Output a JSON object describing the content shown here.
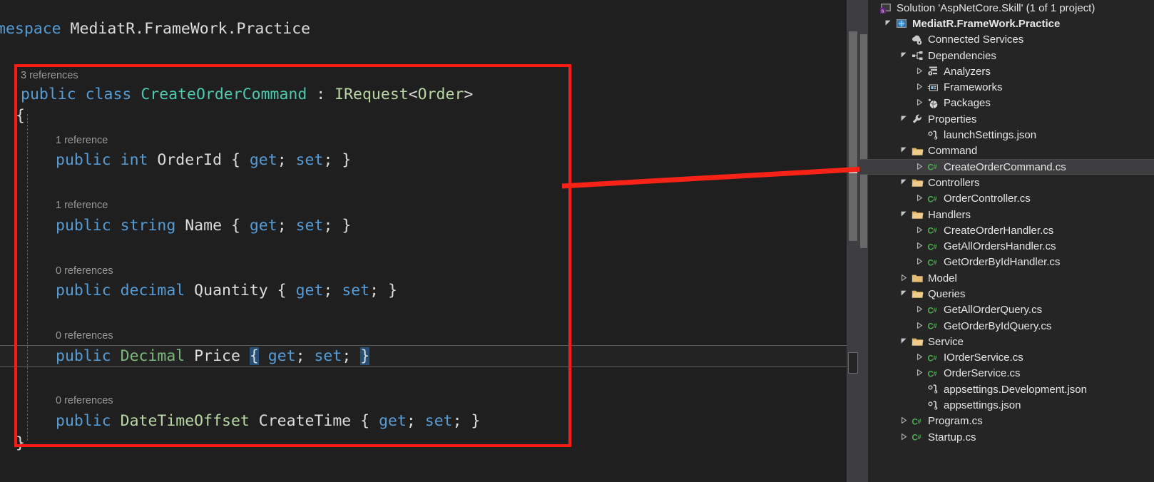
{
  "editor": {
    "namespace_line": {
      "kw": "mespace",
      "name": " MediatR.FrameWork.Practice"
    },
    "lines": [
      {
        "ref": "3 references",
        "tokens": [
          {
            "t": "public",
            "c": "kw"
          },
          {
            "t": " ",
            "c": "plain"
          },
          {
            "t": "class",
            "c": "kw"
          },
          {
            "t": " ",
            "c": "plain"
          },
          {
            "t": "CreateOrderCommand",
            "c": "type"
          },
          {
            "t": " : ",
            "c": "plain"
          },
          {
            "t": "IRequest",
            "c": "iface"
          },
          {
            "t": "<",
            "c": "plain"
          },
          {
            "t": "Order",
            "c": "iface"
          },
          {
            "t": ">",
            "c": "plain"
          }
        ]
      },
      {
        "ref": "1 reference",
        "tokens": [
          {
            "t": "public",
            "c": "kw"
          },
          {
            "t": " ",
            "c": "plain"
          },
          {
            "t": "int",
            "c": "kw"
          },
          {
            "t": " OrderId { ",
            "c": "plain"
          },
          {
            "t": "get",
            "c": "acc"
          },
          {
            "t": "; ",
            "c": "plain"
          },
          {
            "t": "set",
            "c": "acc"
          },
          {
            "t": "; }",
            "c": "plain"
          }
        ]
      },
      {
        "ref": "1 reference",
        "tokens": [
          {
            "t": "public",
            "c": "kw"
          },
          {
            "t": " ",
            "c": "plain"
          },
          {
            "t": "string",
            "c": "kw"
          },
          {
            "t": " Name { ",
            "c": "plain"
          },
          {
            "t": "get",
            "c": "acc"
          },
          {
            "t": "; ",
            "c": "plain"
          },
          {
            "t": "set",
            "c": "acc"
          },
          {
            "t": "; }",
            "c": "plain"
          }
        ]
      },
      {
        "ref": "0 references",
        "tokens": [
          {
            "t": "public",
            "c": "kw"
          },
          {
            "t": " ",
            "c": "plain"
          },
          {
            "t": "decimal",
            "c": "kw"
          },
          {
            "t": " Quantity { ",
            "c": "plain"
          },
          {
            "t": "get",
            "c": "acc"
          },
          {
            "t": "; ",
            "c": "plain"
          },
          {
            "t": "set",
            "c": "acc"
          },
          {
            "t": "; }",
            "c": "plain"
          }
        ]
      },
      {
        "ref": "0 references",
        "tokens": [
          {
            "t": "public",
            "c": "kw"
          },
          {
            "t": " ",
            "c": "plain"
          },
          {
            "t": "Decimal",
            "c": "type2"
          },
          {
            "t": " Price ",
            "c": "plain"
          },
          {
            "t": "{",
            "c": "brace-hl"
          },
          {
            "t": " ",
            "c": "plain"
          },
          {
            "t": "get",
            "c": "acc"
          },
          {
            "t": "; ",
            "c": "plain"
          },
          {
            "t": "set",
            "c": "acc"
          },
          {
            "t": "; ",
            "c": "plain"
          },
          {
            "t": "}",
            "c": "brace-hl"
          }
        ]
      },
      {
        "ref": "0 references",
        "tokens": [
          {
            "t": "public",
            "c": "kw"
          },
          {
            "t": " ",
            "c": "plain"
          },
          {
            "t": "DateTimeOffset",
            "c": "iface"
          },
          {
            "t": " CreateTime { ",
            "c": "plain"
          },
          {
            "t": "get",
            "c": "acc"
          },
          {
            "t": "; ",
            "c": "plain"
          },
          {
            "t": "set",
            "c": "acc"
          },
          {
            "t": "; }",
            "c": "plain"
          }
        ]
      }
    ],
    "open_brace": "{",
    "close_brace": "}"
  },
  "annotation": {
    "box_color": "#fb1b15",
    "arrow_color": "#f92216"
  },
  "solution_explorer": {
    "items": [
      {
        "label": "Solution 'AspNetCore.Skill' (1 of 1 project)",
        "indent": 0,
        "twisty": "none",
        "icon": "solution-icon",
        "bold": false,
        "selected": false
      },
      {
        "label": "MediatR.FrameWork.Practice",
        "indent": 1,
        "twisty": "open",
        "icon": "project-icon",
        "bold": true,
        "selected": false
      },
      {
        "label": "Connected Services",
        "indent": 2,
        "twisty": "none",
        "icon": "connected-services-icon",
        "bold": false,
        "selected": false
      },
      {
        "label": "Dependencies",
        "indent": 2,
        "twisty": "open",
        "icon": "dependencies-icon",
        "bold": false,
        "selected": false
      },
      {
        "label": "Analyzers",
        "indent": 3,
        "twisty": "closed",
        "icon": "analyzers-icon",
        "bold": false,
        "selected": false
      },
      {
        "label": "Frameworks",
        "indent": 3,
        "twisty": "closed",
        "icon": "frameworks-icon",
        "bold": false,
        "selected": false
      },
      {
        "label": "Packages",
        "indent": 3,
        "twisty": "closed",
        "icon": "packages-icon",
        "bold": false,
        "selected": false
      },
      {
        "label": "Properties",
        "indent": 2,
        "twisty": "open",
        "icon": "wrench-icon",
        "bold": false,
        "selected": false
      },
      {
        "label": "launchSettings.json",
        "indent": 3,
        "twisty": "none",
        "icon": "json-file-icon",
        "bold": false,
        "selected": false
      },
      {
        "label": "Command",
        "indent": 2,
        "twisty": "open",
        "icon": "folder-icon",
        "bold": false,
        "selected": false
      },
      {
        "label": "CreateOrderCommand.cs",
        "indent": 3,
        "twisty": "closed",
        "icon": "csharp-file-icon",
        "bold": false,
        "selected": true
      },
      {
        "label": "Controllers",
        "indent": 2,
        "twisty": "open",
        "icon": "folder-icon",
        "bold": false,
        "selected": false
      },
      {
        "label": "OrderController.cs",
        "indent": 3,
        "twisty": "closed",
        "icon": "csharp-file-icon",
        "bold": false,
        "selected": false
      },
      {
        "label": "Handlers",
        "indent": 2,
        "twisty": "open",
        "icon": "folder-icon",
        "bold": false,
        "selected": false
      },
      {
        "label": "CreateOrderHandler.cs",
        "indent": 3,
        "twisty": "closed",
        "icon": "csharp-file-icon",
        "bold": false,
        "selected": false
      },
      {
        "label": "GetAllOrdersHandler.cs",
        "indent": 3,
        "twisty": "closed",
        "icon": "csharp-file-icon",
        "bold": false,
        "selected": false
      },
      {
        "label": "GetOrderByIdHandler.cs",
        "indent": 3,
        "twisty": "closed",
        "icon": "csharp-file-icon",
        "bold": false,
        "selected": false
      },
      {
        "label": "Model",
        "indent": 2,
        "twisty": "closed",
        "icon": "folder-icon",
        "bold": false,
        "selected": false
      },
      {
        "label": "Queries",
        "indent": 2,
        "twisty": "open",
        "icon": "folder-icon",
        "bold": false,
        "selected": false
      },
      {
        "label": "GetAllOrderQuery.cs",
        "indent": 3,
        "twisty": "closed",
        "icon": "csharp-file-icon",
        "bold": false,
        "selected": false
      },
      {
        "label": "GetOrderByIdQuery.cs",
        "indent": 3,
        "twisty": "closed",
        "icon": "csharp-file-icon",
        "bold": false,
        "selected": false
      },
      {
        "label": "Service",
        "indent": 2,
        "twisty": "open",
        "icon": "folder-icon",
        "bold": false,
        "selected": false
      },
      {
        "label": "IOrderService.cs",
        "indent": 3,
        "twisty": "closed",
        "icon": "csharp-file-icon",
        "bold": false,
        "selected": false
      },
      {
        "label": "OrderService.cs",
        "indent": 3,
        "twisty": "closed",
        "icon": "csharp-file-icon",
        "bold": false,
        "selected": false
      },
      {
        "label": "appsettings.Development.json",
        "indent": 3,
        "twisty": "none",
        "icon": "json-file-icon",
        "bold": false,
        "selected": false
      },
      {
        "label": "appsettings.json",
        "indent": 3,
        "twisty": "none",
        "icon": "json-file-icon",
        "bold": false,
        "selected": false
      },
      {
        "label": "Program.cs",
        "indent": 2,
        "twisty": "closed",
        "icon": "csharp-file-icon",
        "bold": false,
        "selected": false
      },
      {
        "label": "Startup.cs",
        "indent": 2,
        "twisty": "closed",
        "icon": "csharp-file-icon",
        "bold": false,
        "selected": false
      }
    ]
  }
}
